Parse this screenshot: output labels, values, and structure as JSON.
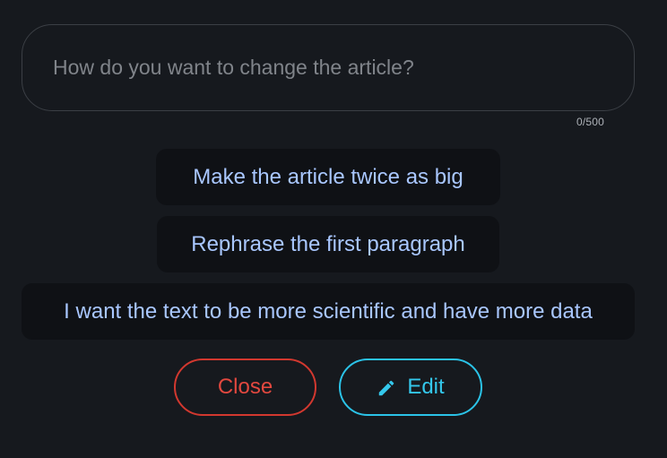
{
  "prompt": {
    "placeholder": "How do you want to change the article?",
    "value": "",
    "counter": "0/500"
  },
  "suggestions": [
    {
      "label": "Make the article twice as big"
    },
    {
      "label": "Rephrase the first paragraph"
    },
    {
      "label": "I want the text to be more scientific and have more data"
    }
  ],
  "actions": {
    "close_label": "Close",
    "edit_label": "Edit",
    "edit_icon": "pencil-icon"
  },
  "colors": {
    "background": "#16191e",
    "suggestion_text": "#a9c7ff",
    "close_accent": "#d2382f",
    "edit_accent": "#2bc3e8"
  }
}
